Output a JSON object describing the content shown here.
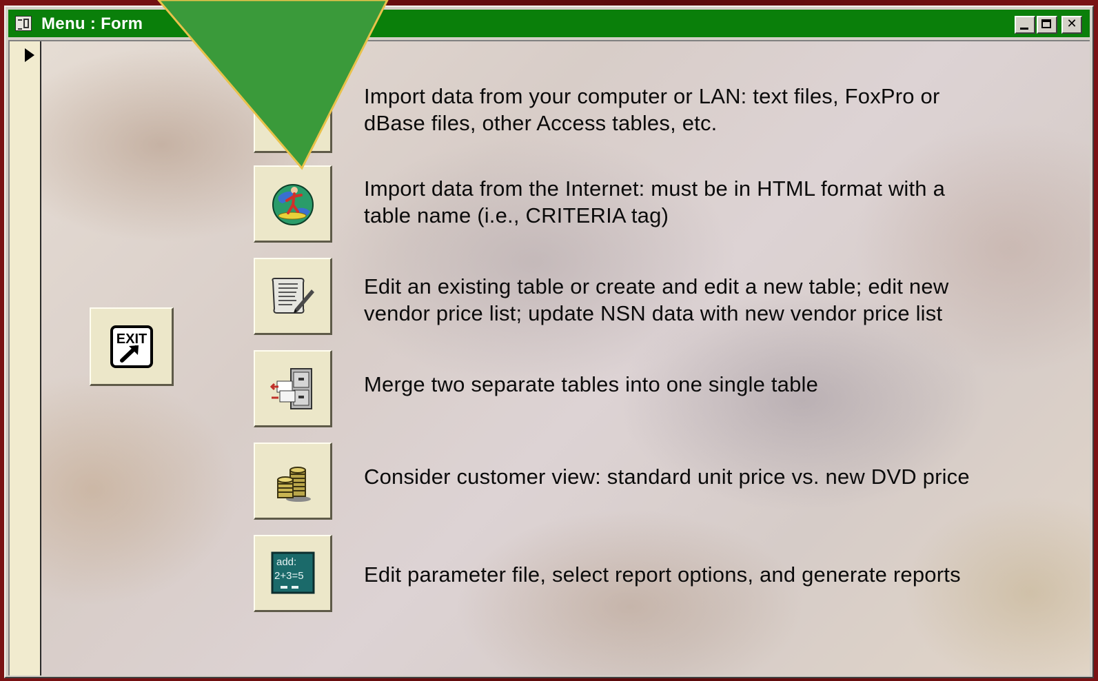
{
  "window": {
    "title": "Menu : Form",
    "controls": [
      "minimize",
      "maximize",
      "close"
    ]
  },
  "colors": {
    "titlebar": "#0a7f0a",
    "button_face": "#ece7c9",
    "arrow_fill": "#3a9a3a",
    "arrow_outline": "#e8c24a",
    "slide_background": "#6b0f10"
  },
  "buttons": [
    {
      "id": "import-file",
      "icon": "import-file-icon",
      "description": "Import data from your computer or LAN: text files, FoxPro or\ndBase files, other Access tables, etc."
    },
    {
      "id": "import-internet",
      "icon": "globe-surfer-icon",
      "description": "Import data from the Internet: must be in HTML format with a\ntable name (i.e., CRITERIA tag)"
    },
    {
      "id": "edit-table",
      "icon": "scroll-pen-icon",
      "description": "Edit an existing table or create and edit a new table; edit new\nvendor price list; update NSN data with new vendor price list"
    },
    {
      "id": "merge-tables",
      "icon": "file-cabinet-icon",
      "description": "Merge two separate tables into one single table"
    },
    {
      "id": "customer-view",
      "icon": "coin-stack-icon",
      "description": "Consider customer view: standard unit price vs. new DVD price"
    },
    {
      "id": "reports",
      "icon": "chalkboard-add-icon",
      "description": "Edit parameter file, select report options, and generate reports",
      "icon_text": {
        "line1": "add:",
        "line2": "2+3=5"
      }
    }
  ],
  "exit_button": {
    "label": "EXIT",
    "icon": "exit-arrow-icon"
  },
  "annotation": {
    "shape": "down-arrow-triangle",
    "points_to": "import-internet"
  }
}
